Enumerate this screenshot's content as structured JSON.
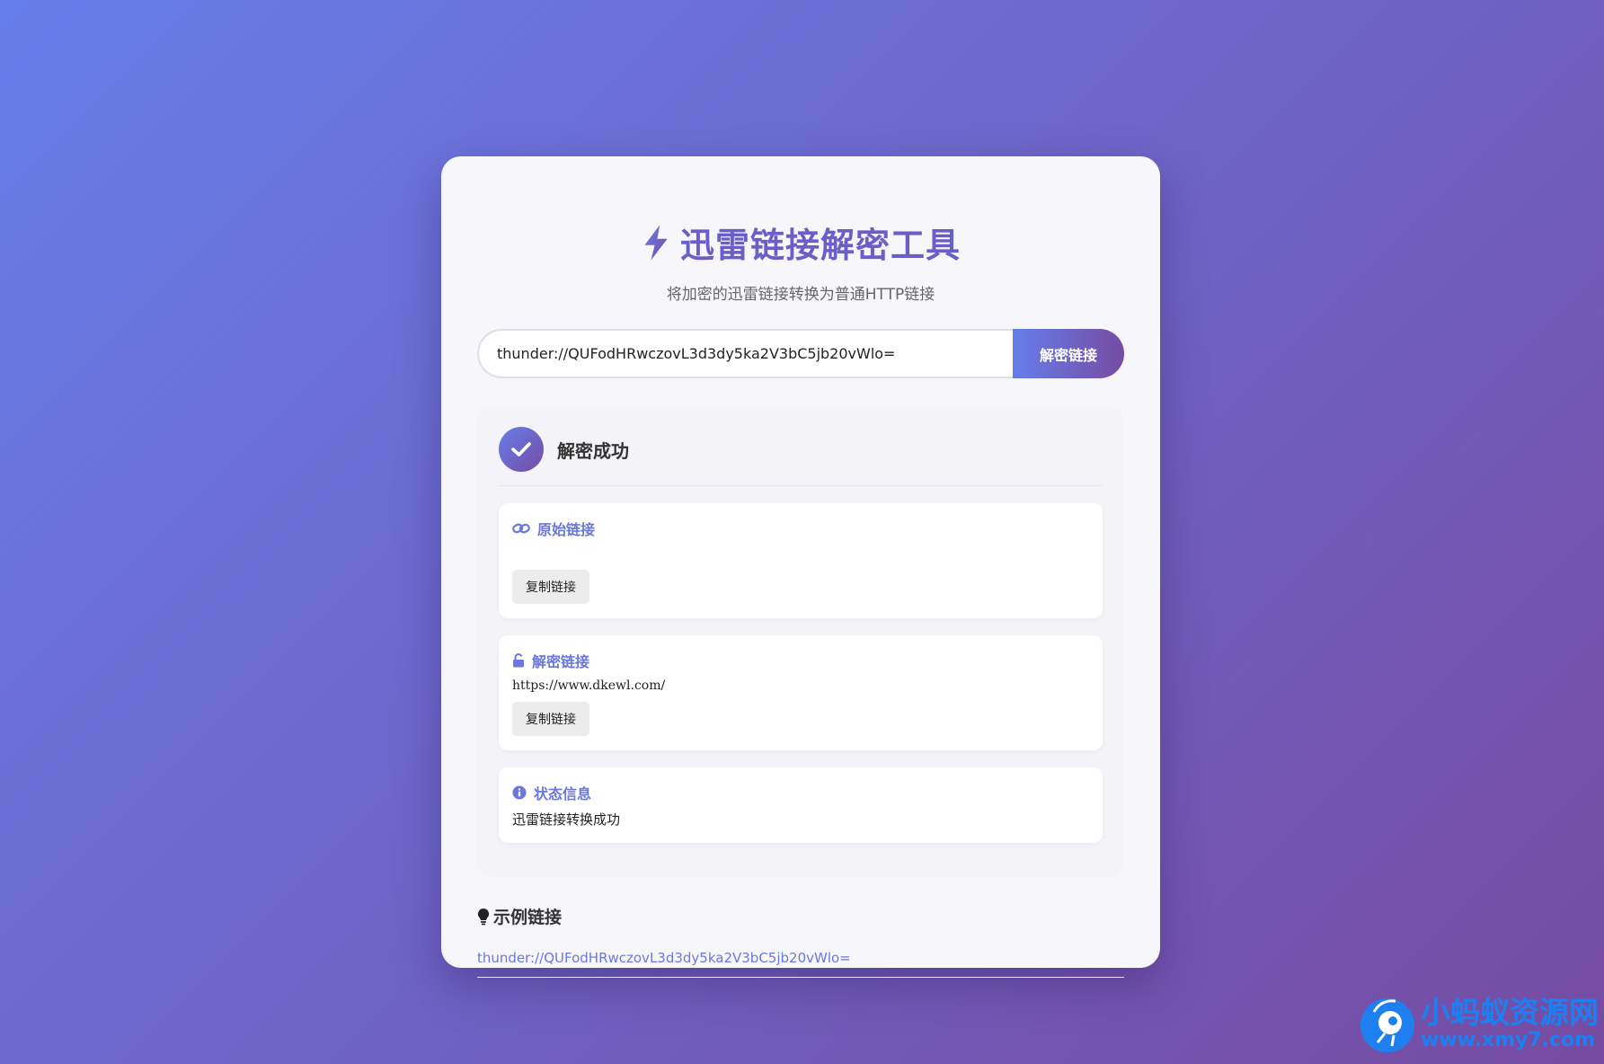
{
  "header": {
    "title": "迅雷链接解密工具",
    "subtitle": "将加密的迅雷链接转换为普通HTTP链接"
  },
  "form": {
    "input_value": "thunder://QUFodHRwczovL3d3dy5ka2V3bC5jb20vWlo=",
    "decrypt_label": "解密链接"
  },
  "result": {
    "title": "解密成功",
    "original": {
      "title": "原始链接",
      "value": "",
      "copy_label": "复制链接"
    },
    "decrypted": {
      "title": "解密链接",
      "value": "https://www.dkewl.com/",
      "copy_label": "复制链接"
    },
    "status": {
      "title": "状态信息",
      "text": "迅雷链接转换成功"
    }
  },
  "examples": {
    "title": "示例链接",
    "items": [
      "thunder://QUFodHRwczovL3d3dy5ka2V3bC5jb20vWlo="
    ]
  },
  "watermark": {
    "name": "小蚂蚁资源网",
    "url": "www.xmy7.com"
  },
  "colors": {
    "gradient_start": "#667eea",
    "gradient_end": "#764ba2",
    "accent": "#6a78de"
  }
}
